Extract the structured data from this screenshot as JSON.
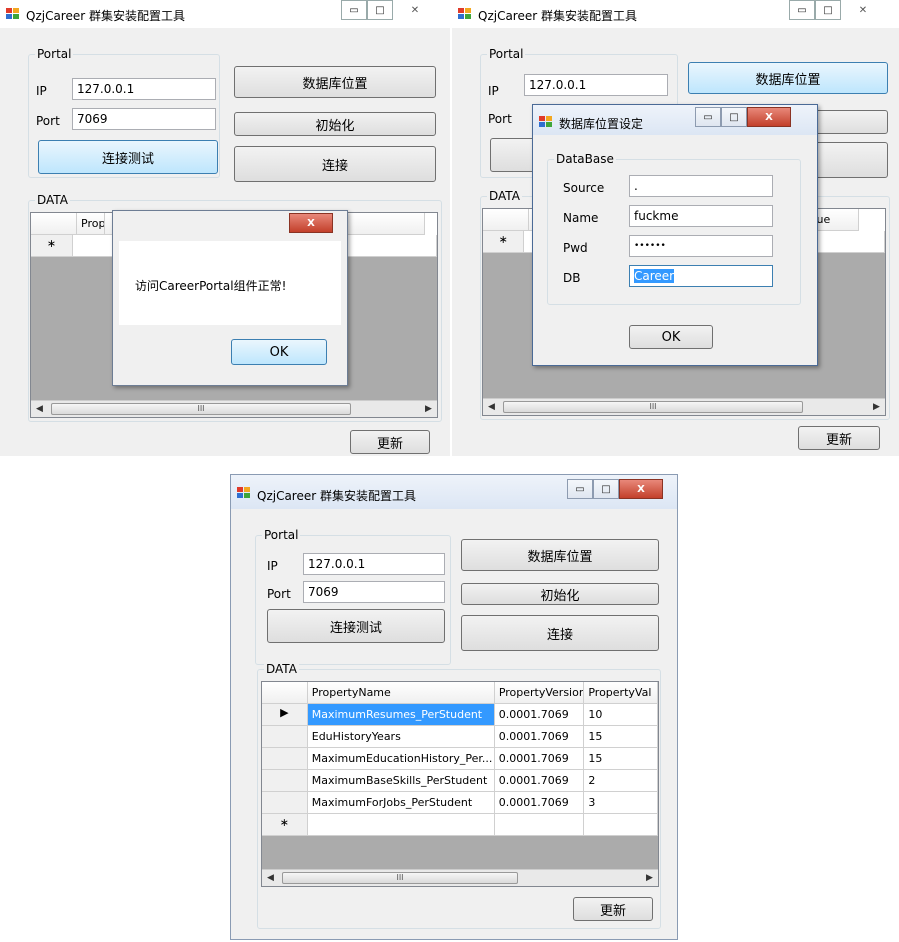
{
  "app": {
    "title": "QzjCareer 群集安装配置工具"
  },
  "portal": {
    "group_label": "Portal",
    "ip_label": "IP",
    "ip_value": "127.0.0.1",
    "port_label": "Port",
    "port_value": "7069"
  },
  "buttons": {
    "db_location": "数据库位置",
    "init": "初始化",
    "connect_test": "连接测试",
    "connect": "连接",
    "update": "更新"
  },
  "data_group": {
    "label": "DATA"
  },
  "grid": {
    "columns": [
      "PropertyName",
      "PropertyVersior",
      "PropertyVal"
    ],
    "partial_headers": [
      "Prope",
      "rtyValue",
      "/alue"
    ],
    "rows": [
      {
        "name": "MaximumResumes_PerStudent",
        "version": "0.0001.7069",
        "value": "10"
      },
      {
        "name": "EduHistoryYears",
        "version": "0.0001.7069",
        "value": "15"
      },
      {
        "name": "MaximumEducationHistory_Per...",
        "version": "0.0001.7069",
        "value": "15"
      },
      {
        "name": "MaximumBaseSkills_PerStudent",
        "version": "0.0001.7069",
        "value": "2"
      },
      {
        "name": "MaximumForJobs_PerStudent",
        "version": "0.0001.7069",
        "value": "3"
      }
    ],
    "new_row_marker": "∗",
    "current_row_marker": "▶"
  },
  "message_box": {
    "text": "访问CareerPortal组件正常!",
    "ok": "OK"
  },
  "db_dialog": {
    "title": "数据库位置设定",
    "group_label": "DataBase",
    "source_label": "Source",
    "source_value": ".",
    "name_label": "Name",
    "name_value": "fuckme",
    "pwd_label": "Pwd",
    "pwd_value": "••••••",
    "db_label": "DB",
    "db_value": "Career",
    "ok": "OK"
  },
  "window_controls": {
    "minimize": "▭",
    "maximize": "□",
    "close": "X",
    "close_alt": "✕"
  },
  "scroll": {
    "thumb_grip": "III",
    "left": "◀",
    "right": "▶"
  },
  "icons": [
    "app-icon",
    "minimize-icon",
    "maximize-icon",
    "close-icon",
    "scroll-left-icon",
    "scroll-right-icon"
  ]
}
